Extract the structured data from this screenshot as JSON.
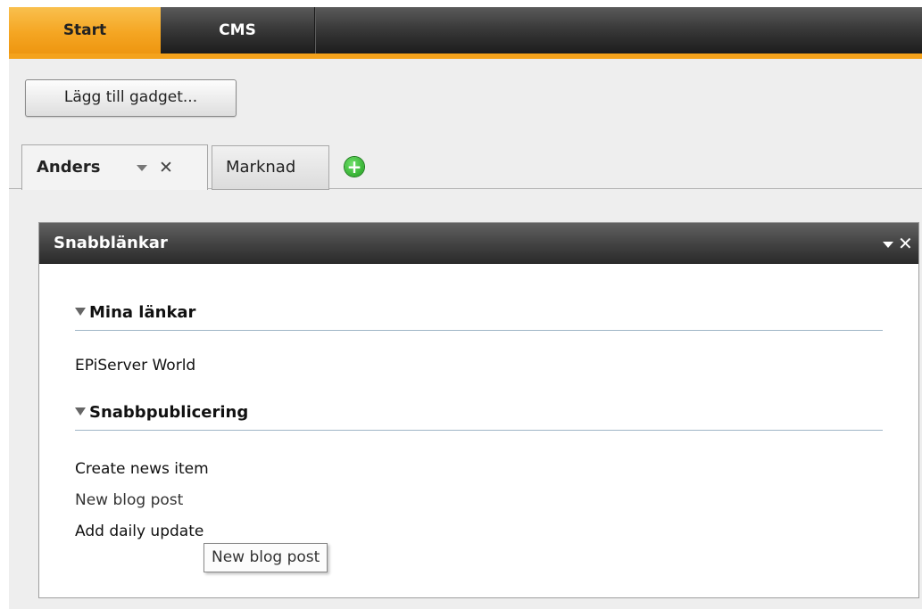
{
  "topnav": {
    "tabs": [
      {
        "label": "Start",
        "active": true
      },
      {
        "label": "CMS",
        "active": false
      }
    ],
    "accent_color": "#f5a623"
  },
  "toolbar": {
    "add_gadget_label": "Lägg till gadget..."
  },
  "dashboard_tabs": {
    "tabs": [
      {
        "label": "Anders",
        "active": true,
        "icons": [
          "chevron-down-icon",
          "close-icon"
        ]
      },
      {
        "label": "Marknad",
        "active": false
      }
    ],
    "add_icon": "plus-circle-icon",
    "add_color": "#2aa52a"
  },
  "gadget": {
    "title": "Snabblänkar",
    "header_icons": [
      "chevron-down-icon",
      "close-icon"
    ],
    "sections": [
      {
        "title": "Mina länkar",
        "links": [
          "EPiServer World"
        ]
      },
      {
        "title": "Snabbpublicering",
        "links": [
          "Create news item",
          "New blog post",
          "Add daily update"
        ]
      }
    ],
    "tooltip": "New blog post"
  }
}
